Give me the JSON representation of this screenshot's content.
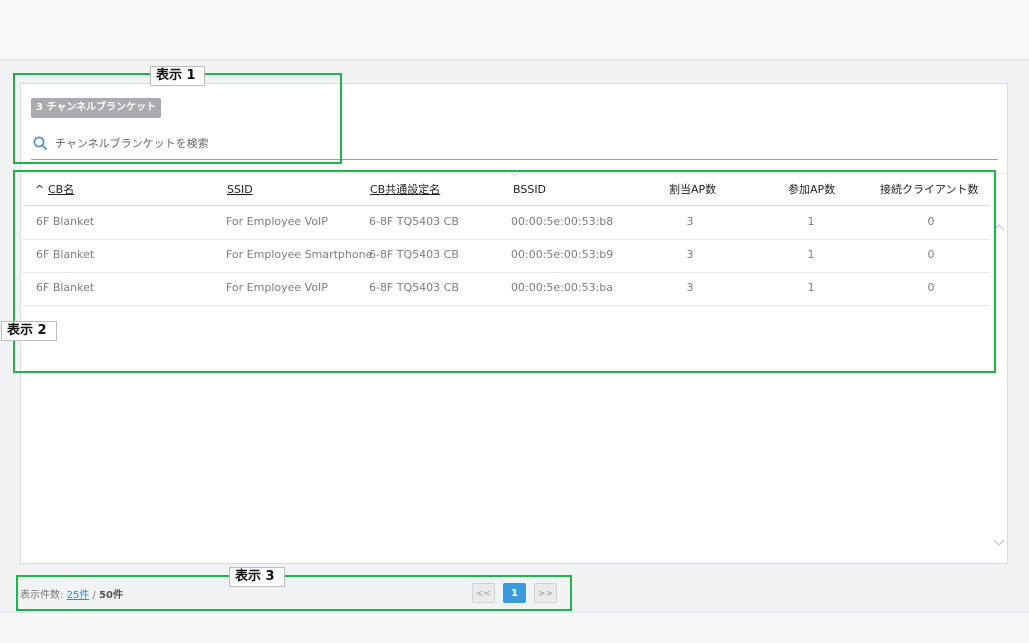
{
  "callouts": {
    "label1": "表示 1",
    "label2": "表示 2",
    "label3": "表示 3"
  },
  "toolbar": {
    "count_badge": "3 チャンネルブランケット"
  },
  "search": {
    "placeholder": "チャンネルブランケットを検索"
  },
  "table": {
    "headers": {
      "cb_name": "CB名",
      "ssid": "SSID",
      "cb_common_setting": "CB共通設定名",
      "bssid": "BSSID",
      "assigned_ap": "割当AP数",
      "joined_ap": "参加AP数",
      "connected_clients": "接続クライアント数"
    },
    "sort_arrow": "^",
    "rows": [
      {
        "cb_name": "6F Blanket",
        "ssid": "For Employee VoIP",
        "cb_common_setting": "6-8F TQ5403 CB",
        "bssid": "00:00:5e:00:53:b8",
        "assigned_ap": "3",
        "joined_ap": "1",
        "connected_clients": "0"
      },
      {
        "cb_name": "6F Blanket",
        "ssid": "For Employee Smartphone",
        "cb_common_setting": "6-8F TQ5403 CB",
        "bssid": "00:00:5e:00:53:b9",
        "assigned_ap": "3",
        "joined_ap": "1",
        "connected_clients": "0"
      },
      {
        "cb_name": "6F Blanket",
        "ssid": "For Employee VoIP",
        "cb_common_setting": "6-8F TQ5403 CB",
        "bssid": "00:00:5e:00:53:ba",
        "assigned_ap": "3",
        "joined_ap": "1",
        "connected_clients": "0"
      }
    ]
  },
  "footer": {
    "display_count_label": "表示件数:",
    "page_size": "25件",
    "separator": "/",
    "total": "50件"
  },
  "pagination": {
    "prev": "<<",
    "current": "1",
    "next": ">>"
  },
  "colors": {
    "highlight_box": "#22b24c",
    "link": "#2e8fd6",
    "active_page": "#3a9bdc"
  }
}
